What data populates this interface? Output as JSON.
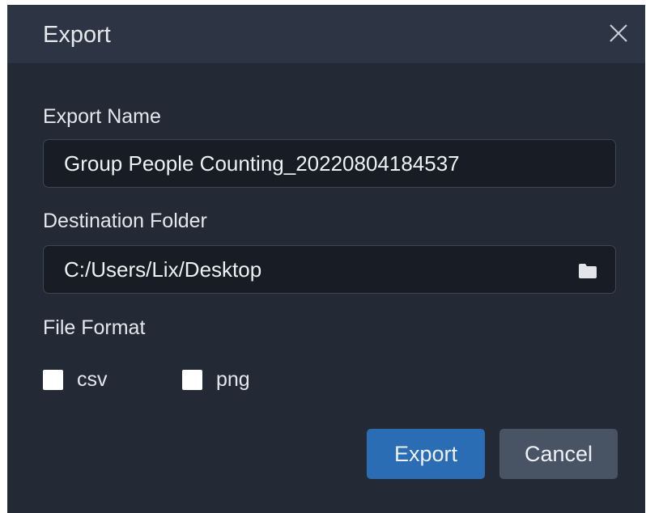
{
  "dialog": {
    "title": "Export",
    "close_icon": "close-icon"
  },
  "export_name": {
    "label": "Export Name",
    "value": "Group People Counting_20220804184537"
  },
  "destination": {
    "label": "Destination Folder",
    "value": "C:/Users/Lix/Desktop",
    "icon": "folder-icon"
  },
  "file_format": {
    "label": "File Format",
    "options": [
      {
        "label": "csv",
        "checked": false
      },
      {
        "label": "png",
        "checked": false
      }
    ]
  },
  "buttons": {
    "export_label": "Export",
    "cancel_label": "Cancel"
  },
  "colors": {
    "dialog_bg": "#242a35",
    "titlebar_bg": "#2d3443",
    "input_bg": "#171c25",
    "primary": "#2a6db5",
    "secondary": "#485364"
  }
}
